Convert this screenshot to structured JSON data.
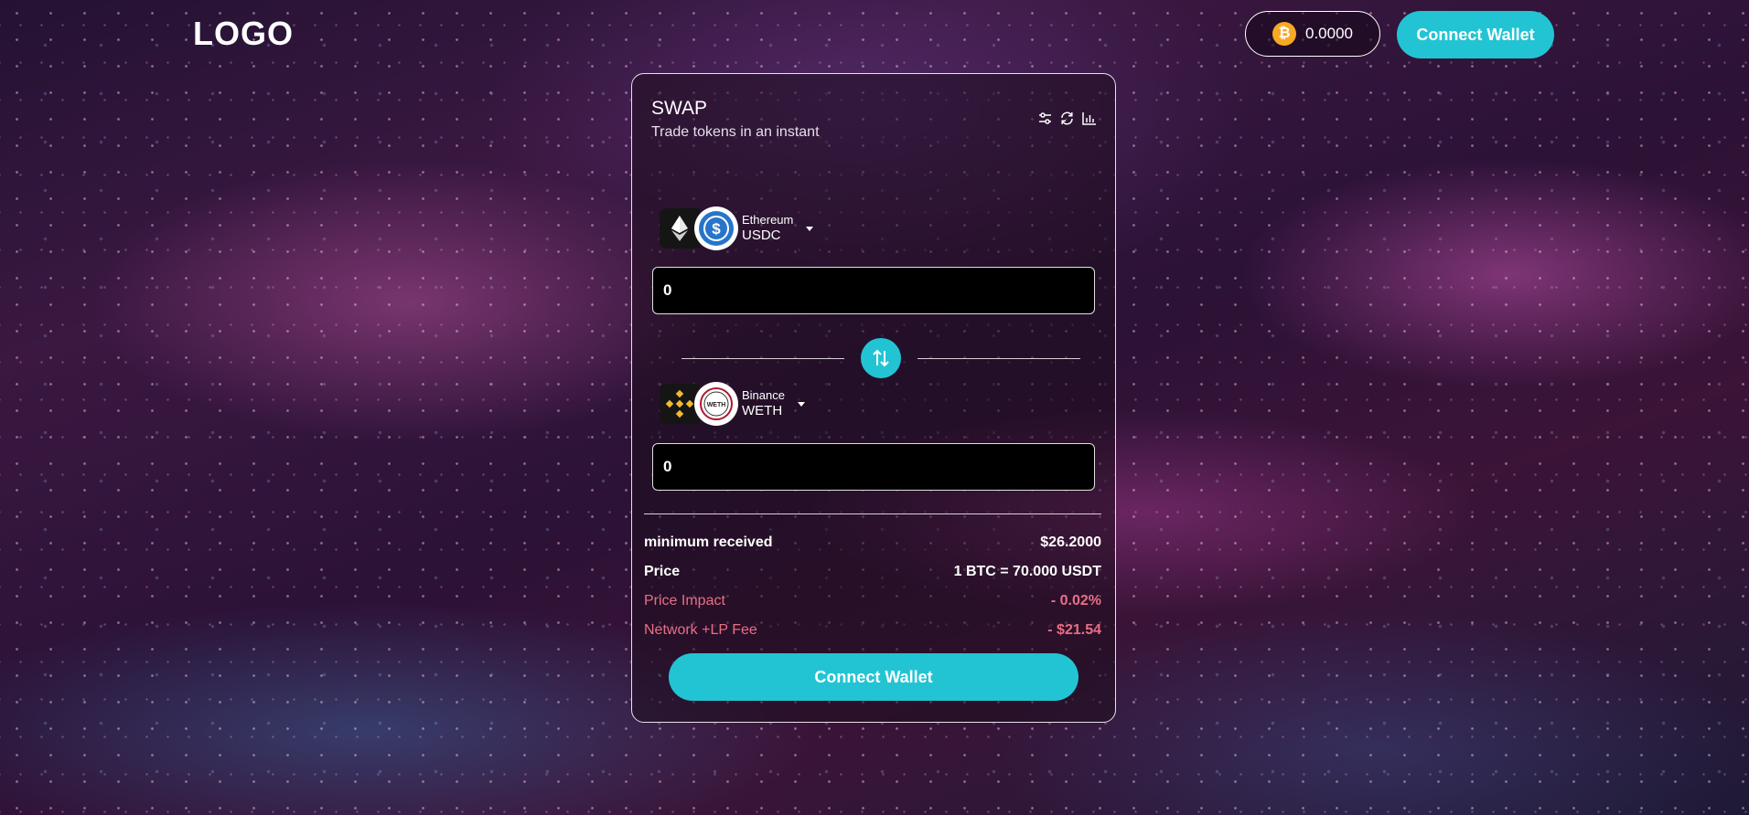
{
  "header": {
    "logo": "LOGO",
    "balance": "0.0000",
    "balance_icon": "bitcoin-coin-icon",
    "connect_label": "Connect Wallet"
  },
  "swap": {
    "title": "SWAP",
    "subtitle": "Trade tokens in an instant",
    "tool_icons": [
      "settings-sliders-icon",
      "refresh-icon",
      "chart-icon"
    ],
    "from": {
      "chain": "Ethereum",
      "token": "USDC",
      "chain_icon": "ethereum-icon",
      "token_icon": "usdc-icon",
      "amount": "0"
    },
    "to": {
      "chain": "Binance",
      "token": "WETH",
      "chain_icon": "binance-icon",
      "token_icon": "weth-icon",
      "amount": "0"
    },
    "info": {
      "min_received_label": "minimum received",
      "min_received_value": "$26.2000",
      "price_label": "Price",
      "price_value": "1 BTC = 70.000 USDT",
      "impact_label": "Price Impact",
      "impact_value": "- 0.02%",
      "fee_label": "Network +LP Fee",
      "fee_value": "- $21.54"
    },
    "connect_label": "Connect Wallet"
  },
  "colors": {
    "accent": "#22c4d4",
    "warning": "#e86f86",
    "usdc_blue": "#2775ca",
    "binance_gold": "#f3ba2f",
    "bitcoin_orange": "#f7a825"
  }
}
